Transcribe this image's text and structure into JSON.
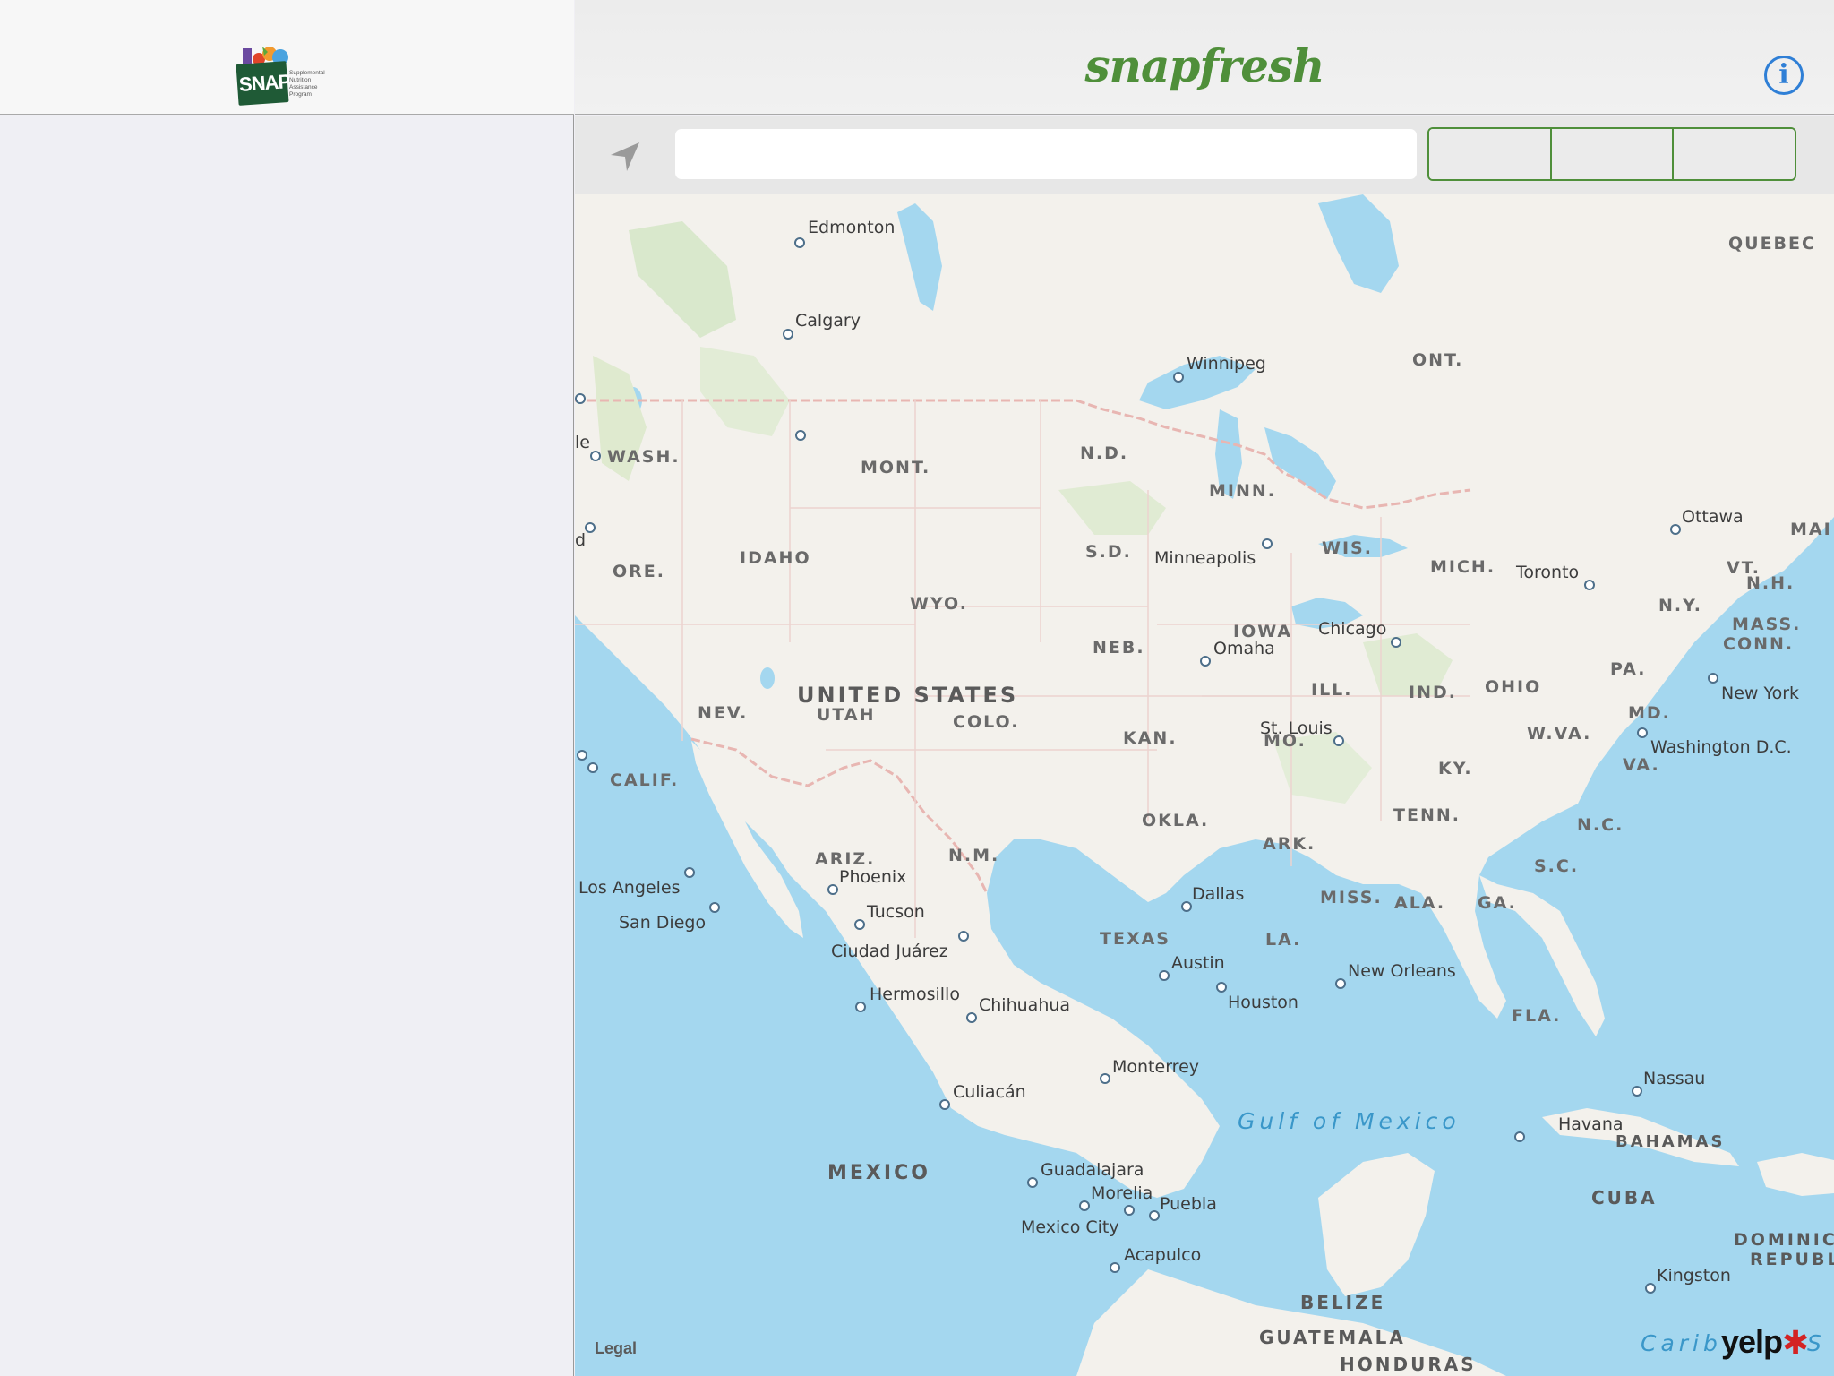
{
  "sidebar": {
    "logo": {
      "badge_text": "SNAP",
      "program_lines": [
        "Supplemental",
        "Nutrition",
        "Assistance",
        "Program"
      ]
    }
  },
  "header": {
    "title": "snapfresh",
    "info_label": "i"
  },
  "search": {
    "value": "",
    "placeholder": "",
    "segments": [
      "",
      "",
      ""
    ]
  },
  "colors": {
    "brand_green": "#4f8f3a",
    "info_blue": "#2f7fd6",
    "water": "#a4d7ef",
    "land": "#f3f1ec"
  },
  "icons": {
    "locate": "location-arrow-icon",
    "info": "info-circle-icon"
  },
  "map": {
    "countries": [
      "UNITED STATES",
      "MEXICO",
      "CUBA",
      "BAHAMAS",
      "BELIZE",
      "GUATEMALA",
      "HONDURAS",
      "DOMINIC",
      "REPUBL"
    ],
    "water_labels": [
      "Gulf of Mexico",
      "Carib",
      "S"
    ],
    "states": [
      "QUEBEC",
      "ONT.",
      "WASH.",
      "MONT.",
      "N.D.",
      "MINN.",
      "ORE.",
      "IDAHO",
      "S.D.",
      "WIS.",
      "MICH.",
      "WYO.",
      "IOWA",
      "NEB.",
      "NEV.",
      "UTAH",
      "COLO.",
      "ILL.",
      "IND.",
      "OHIO",
      "PA.",
      "N.Y.",
      "VT.",
      "N.H.",
      "MASS.",
      "CONN.",
      "MAI",
      "CALIF.",
      "KAN.",
      "MO.",
      "KY.",
      "W.VA.",
      "MD.",
      "VA.",
      "TENN.",
      "N.C.",
      "OKLA.",
      "ARK.",
      "S.C.",
      "ARIZ.",
      "N.M.",
      "TEXAS",
      "MISS.",
      "ALA.",
      "GA.",
      "LA.",
      "FLA."
    ],
    "cities": [
      "Edmonton",
      "Calgary",
      "Winnipeg",
      "Ottawa",
      "Toronto",
      "Minneapolis",
      "Chicago",
      "Omaha",
      "New York",
      "St. Louis",
      "Washington D.C.",
      "Los Angeles",
      "San Diego",
      "Phoenix",
      "Tucson",
      "Ciudad Juárez",
      "Dallas",
      "Austin",
      "Houston",
      "New Orleans",
      "Hermosillo",
      "Chihuahua",
      "Monterrey",
      "Culiacán",
      "Nassau",
      "Havana",
      "Guadalajara",
      "Morelia",
      "Puebla",
      "Mexico City",
      "Acapulco",
      "Kingston",
      "le",
      "d"
    ],
    "legal": "Legal",
    "attribution": "yelp"
  }
}
